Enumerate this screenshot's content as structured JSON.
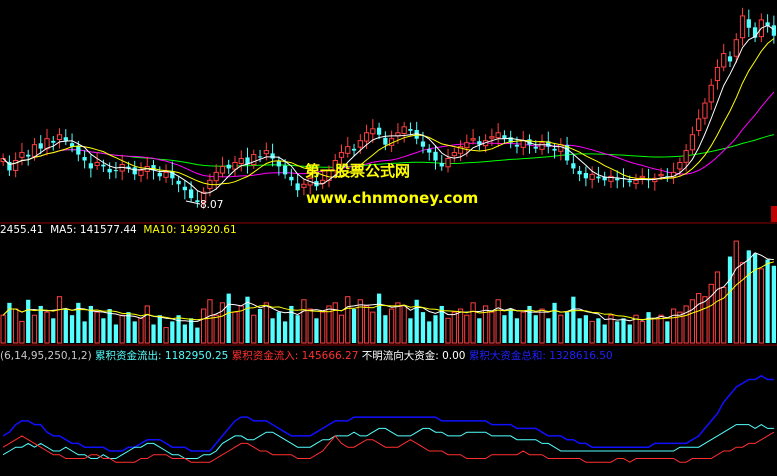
{
  "colors": {
    "background": "#000000",
    "up": "#ff4040",
    "down": "#54ffff",
    "ma5": "#ffffff",
    "ma10": "#ffff00",
    "ma20": "#ff00ff",
    "ma60": "#00ff00",
    "divider": "#8b0000",
    "outflow": "#54ffff",
    "inflow": "#ff3030",
    "total": "#1010ff",
    "watermark": "#ffff00"
  },
  "watermark": {
    "line1": "第一股票公式网",
    "line2": "www.chnmoney.com"
  },
  "price_panel": {
    "low_marker": "8.07"
  },
  "volume_panel": {
    "vol_label": "2455.41",
    "ma5_label": "MA5: 141577.44",
    "ma10_label": "MA10: 149920.61"
  },
  "indicator_panel": {
    "params": "(6,14,95,250,1,2)",
    "outflow_label": "累积资金流出: 1182950.25",
    "inflow_label": "累积资金流入: 145666.27",
    "unknown_label": "不明流向大资金: 0.00",
    "total_label": "累积大资金总和: 1328616.50"
  },
  "chart_data": [
    {
      "type": "candlestick",
      "close": [
        10.6,
        10.0,
        10.5,
        10.9,
        10.7,
        11.3,
        11.1,
        11.6,
        11.4,
        11.8,
        11.5,
        11.2,
        10.8,
        10.5,
        10.1,
        10.4,
        10.2,
        9.9,
        10.0,
        10.3,
        10.1,
        9.8,
        10.0,
        10.2,
        10.0,
        9.7,
        9.9,
        9.6,
        9.3,
        9.0,
        8.6,
        8.4,
        8.9,
        9.5,
        9.9,
        10.2,
        10.1,
        10.4,
        10.6,
        10.3,
        10.8,
        10.7,
        11.0,
        10.6,
        10.2,
        9.8,
        9.5,
        9.0,
        9.3,
        9.6,
        9.2,
        9.5,
        10.0,
        10.5,
        10.9,
        11.2,
        11.0,
        11.5,
        11.9,
        12.1,
        11.8,
        11.3,
        11.6,
        11.9,
        12.2,
        12.0,
        11.6,
        11.2,
        10.9,
        10.5,
        10.2,
        10.6,
        10.9,
        11.2,
        11.4,
        11.6,
        11.3,
        11.5,
        11.7,
        11.9,
        11.6,
        11.4,
        11.2,
        11.5,
        11.3,
        11.1,
        11.4,
        11.2,
        11.0,
        11.3,
        10.5,
        10.1,
        9.8,
        9.6,
        9.8,
        9.6,
        9.5,
        9.7,
        9.5,
        9.6,
        9.4,
        9.5,
        9.7,
        9.5,
        9.6,
        9.8,
        9.7,
        9.9,
        10.4,
        11.0,
        11.8,
        12.6,
        13.4,
        14.3,
        15.2,
        15.9,
        15.5,
        16.6,
        17.8,
        17.2,
        16.7,
        17.6,
        17.3,
        16.8
      ],
      "low_label": "8.07"
    },
    {
      "type": "bar",
      "series": [
        {
          "name": "MA5",
          "values": [
            141577.44
          ]
        },
        {
          "name": "MA10",
          "values": [
            149920.61
          ]
        }
      ],
      "volume": [
        9,
        13,
        11,
        7,
        14,
        9,
        12,
        10,
        8,
        15,
        11,
        9,
        13,
        7,
        12,
        10,
        8,
        11,
        6,
        9,
        10,
        7,
        8,
        12,
        6,
        9,
        5,
        7,
        9,
        6,
        8,
        5,
        11,
        14,
        9,
        13,
        16,
        10,
        12,
        15,
        9,
        11,
        13,
        8,
        10,
        7,
        12,
        9,
        14,
        11,
        8,
        10,
        12,
        13,
        9,
        15,
        11,
        14,
        12,
        10,
        16,
        9,
        11,
        13,
        12,
        8,
        14,
        10,
        7,
        9,
        12,
        8,
        10,
        11,
        9,
        13,
        8,
        12,
        10,
        14,
        9,
        11,
        8,
        10,
        12,
        9,
        11,
        8,
        13,
        9,
        10,
        15,
        8,
        9,
        7,
        8,
        6,
        9,
        7,
        8,
        6,
        9,
        7,
        10,
        8,
        9,
        7,
        11,
        10,
        12,
        14,
        16,
        15,
        19,
        23,
        18,
        28,
        33,
        26,
        30,
        29,
        24,
        27,
        25
      ]
    },
    {
      "type": "line",
      "series": [
        {
          "name": "累积资金流出",
          "values": [
            3,
            4,
            5,
            5,
            6,
            5,
            6,
            5,
            4,
            4,
            5,
            4,
            3,
            3,
            2,
            2,
            3,
            2,
            2,
            3,
            4,
            5,
            5,
            6,
            6,
            5,
            4,
            3,
            3,
            2,
            2,
            2,
            3,
            3,
            4,
            6,
            7,
            8,
            8,
            7,
            7,
            8,
            9,
            9,
            8,
            7,
            6,
            5,
            5,
            5,
            6,
            7,
            7,
            8,
            8,
            8,
            9,
            8,
            8,
            9,
            10,
            10,
            9,
            8,
            8,
            8,
            9,
            10,
            10,
            9,
            9,
            8,
            8,
            8,
            9,
            9,
            9,
            9,
            8,
            8,
            8,
            8,
            7,
            7,
            7,
            7,
            6,
            6,
            5,
            4,
            4,
            4,
            4,
            4,
            4,
            4,
            4,
            4,
            4,
            4,
            4,
            4,
            4,
            4,
            4,
            4,
            4,
            4,
            5,
            5,
            5,
            5,
            6,
            7,
            8,
            9,
            10,
            11,
            11,
            11,
            10,
            11,
            10,
            10
          ]
        },
        {
          "name": "累积资金流入",
          "values": [
            5,
            6,
            7,
            8,
            7,
            6,
            5,
            4,
            3,
            3,
            2,
            2,
            2,
            2,
            3,
            3,
            2,
            2,
            1,
            1,
            1,
            1,
            2,
            2,
            3,
            3,
            3,
            2,
            2,
            2,
            1,
            1,
            1,
            1,
            2,
            3,
            4,
            5,
            6,
            6,
            5,
            4,
            4,
            3,
            3,
            3,
            3,
            2,
            2,
            2,
            3,
            4,
            6,
            8,
            6,
            5,
            5,
            6,
            7,
            7,
            6,
            5,
            5,
            5,
            6,
            7,
            6,
            5,
            4,
            4,
            4,
            3,
            3,
            3,
            2,
            2,
            2,
            2,
            3,
            3,
            3,
            3,
            3,
            4,
            3,
            3,
            3,
            2,
            2,
            2,
            2,
            2,
            2,
            1,
            1,
            1,
            1,
            1,
            2,
            2,
            1,
            2,
            2,
            2,
            2,
            2,
            2,
            2,
            1,
            1,
            2,
            2,
            2,
            2,
            3,
            4,
            4,
            5,
            5,
            6,
            6,
            7,
            8,
            9
          ]
        },
        {
          "name": "累积大资金总和",
          "values": [
            8,
            9,
            11,
            12,
            12,
            11,
            11,
            9,
            8,
            8,
            7,
            6,
            6,
            5,
            5,
            5,
            5,
            4,
            4,
            4,
            5,
            5,
            6,
            7,
            7,
            7,
            6,
            5,
            5,
            5,
            4,
            4,
            4,
            4,
            6,
            8,
            10,
            12,
            13,
            13,
            12,
            12,
            12,
            11,
            10,
            9,
            8,
            8,
            8,
            8,
            9,
            10,
            11,
            12,
            12,
            12,
            13,
            13,
            13,
            13,
            13,
            13,
            13,
            13,
            13,
            13,
            13,
            13,
            13,
            13,
            12,
            12,
            12,
            12,
            12,
            12,
            12,
            12,
            11,
            11,
            11,
            11,
            10,
            10,
            10,
            10,
            9,
            8,
            8,
            8,
            7,
            7,
            6,
            6,
            5,
            5,
            5,
            5,
            5,
            5,
            5,
            5,
            5,
            5,
            6,
            6,
            6,
            6,
            6,
            6,
            7,
            8,
            10,
            12,
            14,
            17,
            19,
            21,
            22,
            23,
            23,
            24,
            23,
            23
          ]
        }
      ]
    }
  ]
}
